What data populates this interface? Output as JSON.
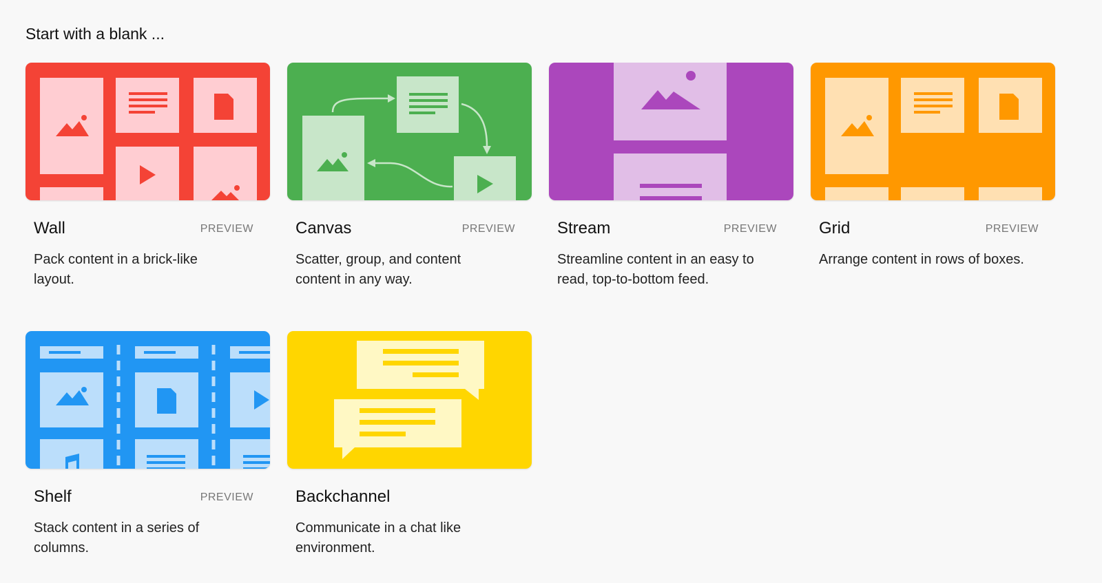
{
  "heading": "Start with a blank ...",
  "cards": [
    {
      "title": "Wall",
      "badge": "PREVIEW",
      "description": "Pack content in a brick-like layout.",
      "color": "#f44336"
    },
    {
      "title": "Canvas",
      "badge": "PREVIEW",
      "description": "Scatter, group, and content content in any way.",
      "color": "#4caf50"
    },
    {
      "title": "Stream",
      "badge": "PREVIEW",
      "description": "Streamline content in an easy to read, top-to-bottom feed.",
      "color": "#ab47bc"
    },
    {
      "title": "Grid",
      "badge": "PREVIEW",
      "description": "Arrange content in rows of boxes.",
      "color": "#ff9800"
    },
    {
      "title": "Shelf",
      "badge": "PREVIEW",
      "description": "Stack content in a series of columns.",
      "color": "#2196f3"
    },
    {
      "title": "Backchannel",
      "description": "Communicate in a chat like environment.",
      "color": "#ffd600"
    }
  ]
}
